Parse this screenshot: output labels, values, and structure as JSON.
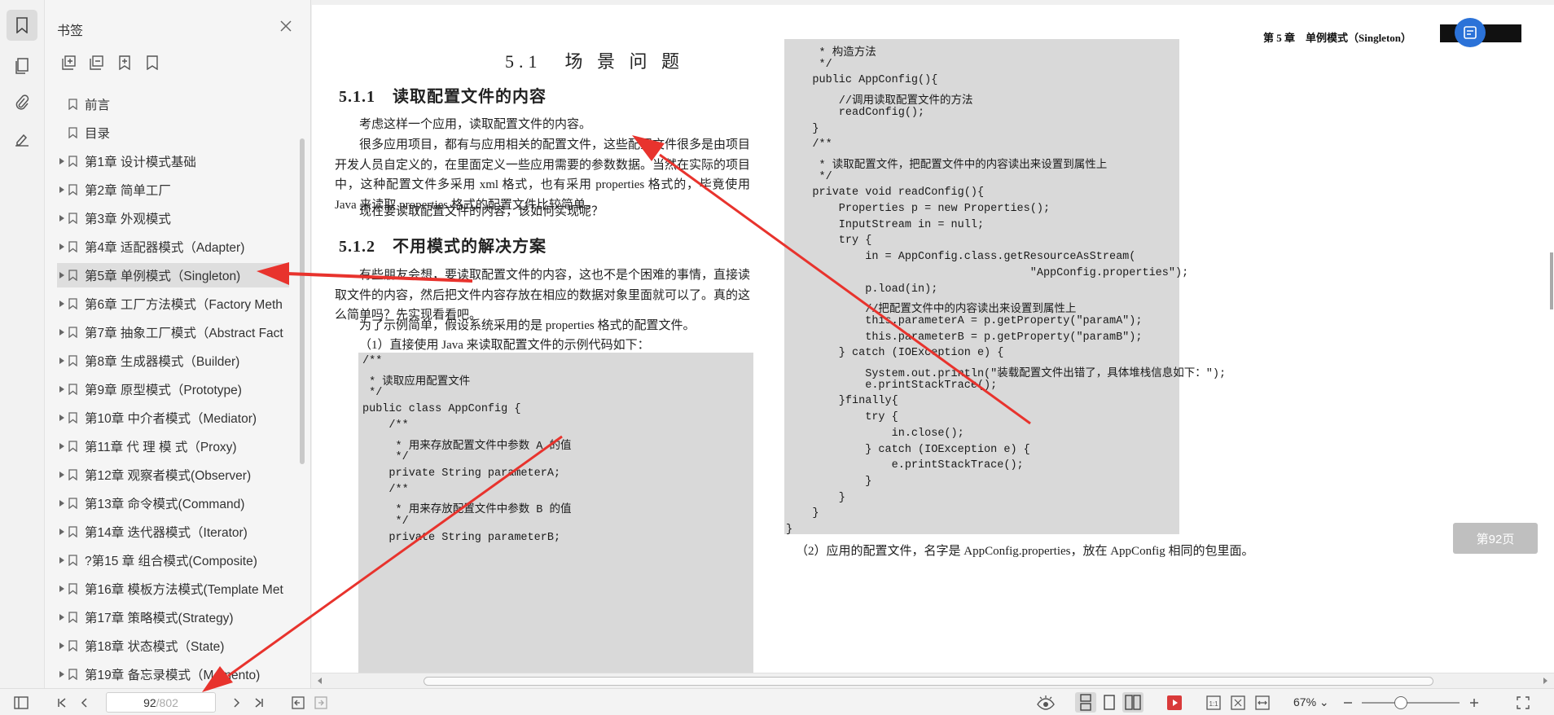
{
  "sidebar_panel": {
    "title": "书签",
    "items": [
      {
        "label": "前言",
        "expandable": false,
        "selected": false
      },
      {
        "label": "目录",
        "expandable": false,
        "selected": false
      },
      {
        "label": "第1章 设计模式基础",
        "expandable": true,
        "selected": false
      },
      {
        "label": "第2章 简单工厂",
        "expandable": true,
        "selected": false
      },
      {
        "label": "第3章 外观模式",
        "expandable": true,
        "selected": false
      },
      {
        "label": "第4章 适配器模式（Adapter)",
        "expandable": true,
        "selected": false
      },
      {
        "label": "第5章 单例模式（Singleton)",
        "expandable": true,
        "selected": true
      },
      {
        "label": "第6章 工厂方法模式（Factory Meth",
        "expandable": true,
        "selected": false
      },
      {
        "label": "第7章 抽象工厂模式（Abstract Fact",
        "expandable": true,
        "selected": false
      },
      {
        "label": "第8章 生成器模式（Builder)",
        "expandable": true,
        "selected": false
      },
      {
        "label": "第9章 原型模式（Prototype)",
        "expandable": true,
        "selected": false
      },
      {
        "label": "第10章 中介者模式（Mediator)",
        "expandable": true,
        "selected": false
      },
      {
        "label": "第11章 代 理 模 式（Proxy)",
        "expandable": true,
        "selected": false
      },
      {
        "label": "第12章 观察者模式(Observer)",
        "expandable": true,
        "selected": false
      },
      {
        "label": "第13章 命令模式(Command)",
        "expandable": true,
        "selected": false
      },
      {
        "label": "第14章 迭代器模式（Iterator)",
        "expandable": true,
        "selected": false
      },
      {
        "label": "?第15 章 组合模式(Composite)",
        "expandable": true,
        "selected": false
      },
      {
        "label": "第16章 模板方法模式(Template Met",
        "expandable": true,
        "selected": false
      },
      {
        "label": "第17章 策略模式(Strategy)",
        "expandable": true,
        "selected": false
      },
      {
        "label": "第18章 状态模式（State)",
        "expandable": true,
        "selected": false
      },
      {
        "label": "第19章 备忘录模式（Memento)",
        "expandable": true,
        "selected": false
      }
    ]
  },
  "left_page": {
    "section_title": "5.1　场 景 问 题",
    "h_511": "5.1.1　读取配置文件的内容",
    "p1": "考虑这样一个应用，读取配置文件的内容。",
    "p2": "很多应用项目，都有与应用相关的配置文件，这些配置文件很多是由项目开发人员自定义的，在里面定义一些应用需要的参数数据。当然在实际的项目中，这种配置文件多采用 xml 格式，也有采用 properties 格式的，毕竟使用 Java 来读取 properties 格式的配置文件比较简单。",
    "p3": "现在要读取配置文件的内容，该如何实现呢？",
    "h_512": "5.1.2　不用模式的解决方案",
    "p4": "有些朋友会想，要读取配置文件的内容，这也不是个困难的事情，直接读取文件的内容，然后把文件内容存放在相应的数据对象里面就可以了。真的这么简单吗？先实现看看吧。",
    "p5": "为了示例简单，假设系统采用的是 properties 格式的配置文件。",
    "p6": "（1）直接使用 Java 来读取配置文件的示例代码如下：",
    "code": [
      "/**",
      " * 读取应用配置文件",
      " */",
      "public class AppConfig {",
      "    /**",
      "     * 用来存放配置文件中参数 A 的值",
      "     */",
      "    private String parameterA;",
      "    /**",
      "     * 用来存放配置文件中参数 B 的值",
      "     */",
      "    private String parameterB;"
    ]
  },
  "right_page": {
    "running_header": "第 5 章　单例模式（Singleton）",
    "code": [
      "     * 构造方法",
      "     */",
      "    public AppConfig(){",
      "        //调用读取配置文件的方法",
      "        readConfig();",
      "    }",
      "    /**",
      "     * 读取配置文件，把配置文件中的内容读出来设置到属性上",
      "     */",
      "    private void readConfig(){",
      "        Properties p = new Properties();",
      "        InputStream in = null;",
      "        try {",
      "            in = AppConfig.class.getResourceAsStream(",
      "                                     \"AppConfig.properties\");",
      "            p.load(in);",
      "            //把配置文件中的内容读出来设置到属性上",
      "            this.parameterA = p.getProperty(\"paramA\");",
      "            this.parameterB = p.getProperty(\"paramB\");",
      "        } catch (IOException e) {",
      "            System.out.println(\"装载配置文件出错了，具体堆栈信息如下：\");",
      "            e.printStackTrace();",
      "        }finally{",
      "            try {",
      "                in.close();",
      "            } catch (IOException e) {",
      "                e.printStackTrace();",
      "            }",
      "        }",
      "    }",
      "}"
    ],
    "caption": "（2）应用的配置文件，名字是 AppConfig.properties，放在 AppConfig 相同的包里面。",
    "page_chip": "第92页"
  },
  "bottom_bar": {
    "current_page": "92",
    "total_pages": "/802",
    "zoom": "67%",
    "zoom_level_fraction": 0.4
  },
  "annotation_color": "#e8332d",
  "accent_color": "#2b72d8"
}
